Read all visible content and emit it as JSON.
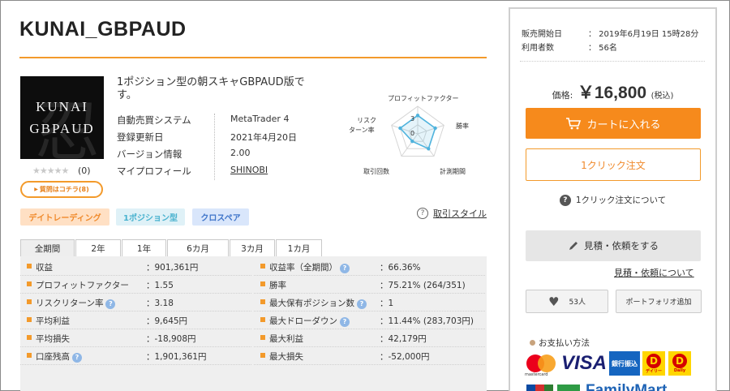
{
  "product": {
    "title": "KUNAI_GBPAUD",
    "logo_line1": "KUNAI",
    "logo_line2": "GBPAUD",
    "logo_kanji": "忍",
    "stars": "★★★★★",
    "review_count": "(0)",
    "question_button": "質問はコチラ(8)",
    "description": "1ポジション型の朝スキャGBPAUD版です。"
  },
  "specs": [
    {
      "label": "自動売買システム",
      "value": "MetaTrader 4"
    },
    {
      "label": "登録更新日",
      "value": "2021年4月20日"
    },
    {
      "label": "バージョン情報",
      "value": "2.00"
    },
    {
      "label": "マイプロフィール",
      "value": "SHINOBI"
    }
  ],
  "radar": {
    "axes": [
      "プロフィットファクター",
      "勝率",
      "計測期間",
      "取引回数",
      "リスクリターン率"
    ],
    "label_profit_factor": "プロフィットファクター",
    "label_winrate": "勝率",
    "label_period": "計測期間",
    "label_trades": "取引回数",
    "label_risk": "リスク",
    "label_risk2": "ターン率",
    "label_risk_prefix": "リ",
    "scale_max": "3",
    "scale_min": "0",
    "values": [
      2,
      2,
      2,
      1,
      2
    ]
  },
  "tags": {
    "day": "デイトレーディング",
    "one": "1ポジション型",
    "cross": "クロスペア"
  },
  "style_link": "取引スタイル",
  "tabs": [
    "全期間",
    "2年",
    "1年",
    "6カ月",
    "3カ月",
    "1カ月"
  ],
  "stats_left": [
    {
      "label": "収益",
      "value": "：901,361円",
      "help": false
    },
    {
      "label": "プロフィットファクター",
      "value": "：1.55",
      "help": false
    },
    {
      "label": "リスクリターン率",
      "value": "：3.18",
      "help": true
    },
    {
      "label": "平均利益",
      "value": "：9,645円",
      "help": false
    },
    {
      "label": "平均損失",
      "value": "：-18,908円",
      "help": false
    },
    {
      "label": "口座残高",
      "value": "：1,901,361円",
      "help": true
    }
  ],
  "stats_right": [
    {
      "label": "収益率（全期間）",
      "value": "：66.36%",
      "help": true
    },
    {
      "label": "勝率",
      "value": "：75.21% (264/351)",
      "help": false
    },
    {
      "label": "最大保有ポジション数",
      "value": "：1",
      "help": true
    },
    {
      "label": "最大ドローダウン",
      "value": "：11.44% (283,703円)",
      "help": true
    },
    {
      "label": "最大利益",
      "value": "：42,179円",
      "help": false
    },
    {
      "label": "最大損失",
      "value": "：-52,000円",
      "help": false
    }
  ],
  "sidebar": {
    "sale_start_label": "販売開始日",
    "sale_start_value": "：  2019年6月19日 15時28分",
    "users_label": "利用者数",
    "users_value": "：  56名",
    "price_label": "価格:",
    "price_value": "￥16,800",
    "price_tax": "(税込)",
    "cart_button": "カートに入れる",
    "oneclick_button": "1クリック注文",
    "about_oneclick": "1クリック注文について",
    "quote_button": "見積・依頼をする",
    "quote_link": "見積・依頼について",
    "like_count": "53人",
    "portfolio_button": "ポートフォリオ追加",
    "payment_heading": "お支払い方法",
    "payment_mastercard": "mastercard",
    "payment_visa": "VISA",
    "payment_bank": "銀行振込",
    "payment_daily1": "D",
    "payment_daily1_text": "デイリー",
    "payment_daily2": "D",
    "payment_daily2_text": "Daily",
    "payment_familymart": "FamilyMart"
  },
  "colors": {
    "accent": "#f39a2b",
    "cart": "#f68a1c",
    "radar_line": "#4fb3dd"
  }
}
